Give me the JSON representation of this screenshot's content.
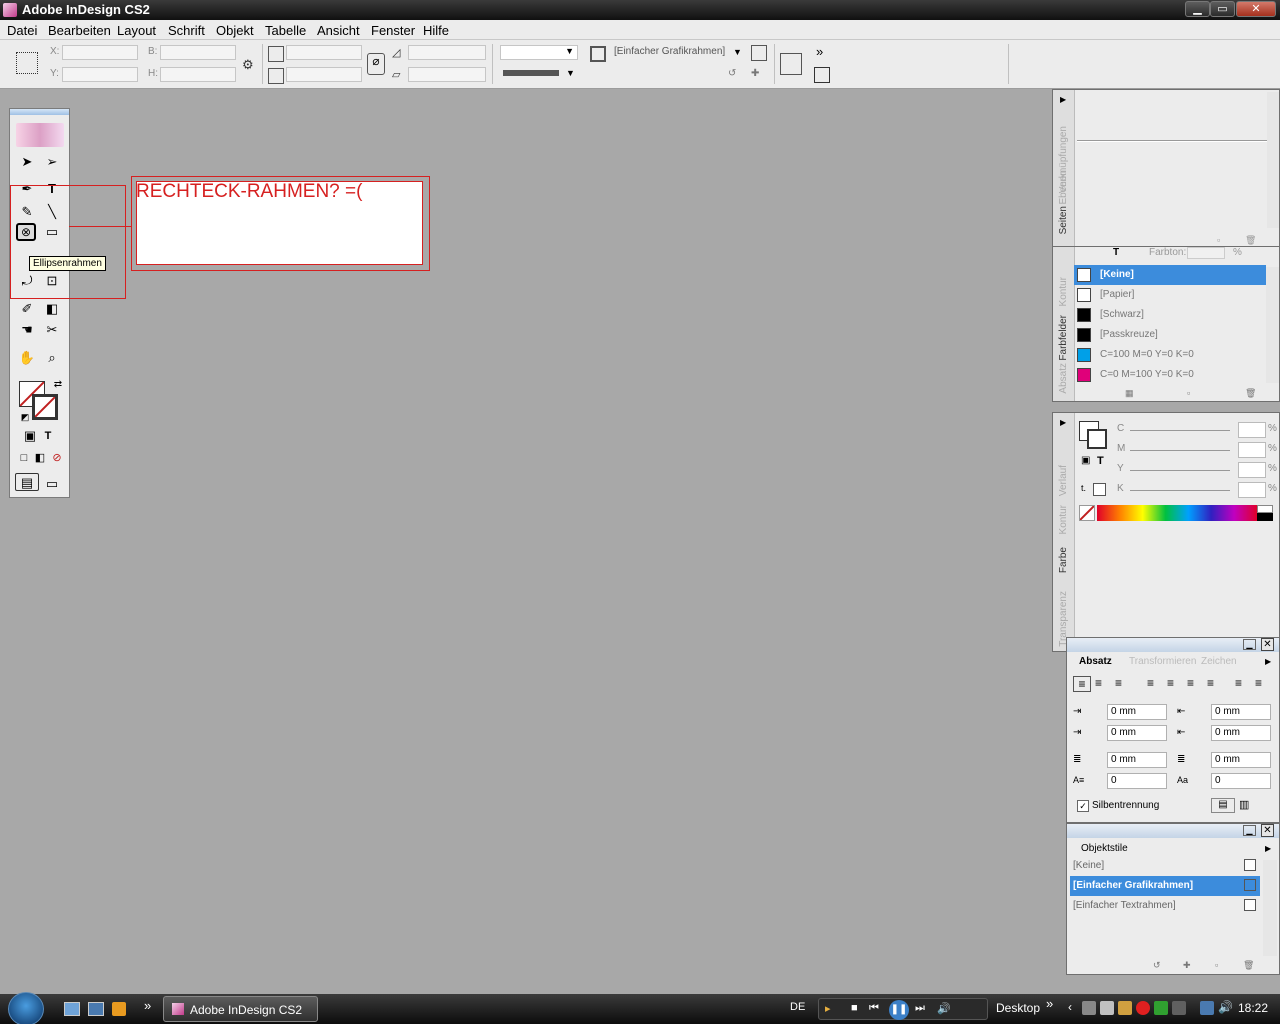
{
  "window": {
    "title": "Adobe InDesign CS2",
    "minimize": "▁",
    "maximize": "▭",
    "close": "✕"
  },
  "menu": [
    "Datei",
    "Bearbeiten",
    "Layout",
    "Schrift",
    "Objekt",
    "Tabelle",
    "Ansicht",
    "Fenster",
    "Hilfe"
  ],
  "control": {
    "x_label": "X:",
    "y_label": "Y:",
    "w_label": "B:",
    "h_label": "H:",
    "object_style": "[Einfacher Grafikrahmen]",
    "more": "»"
  },
  "document": {
    "frame_text": "RECHTECK-RAHMEN? =(",
    "tooltip": "Ellipsenrahmen"
  },
  "pages_panel": {
    "tabs": [
      "Seiten",
      "Ebenen",
      "Verknüpfungen"
    ]
  },
  "swatches_panel": {
    "tint_label": "Farbton:",
    "tint_unit": "%",
    "tabs": [
      "Farbfelder",
      "Absatz",
      "Kontur"
    ],
    "items": [
      {
        "name": "[Keine]",
        "color": "#ffffff",
        "selected": true
      },
      {
        "name": "[Papier]",
        "color": "#ffffff",
        "selected": false
      },
      {
        "name": "[Schwarz]",
        "color": "#000000",
        "selected": false
      },
      {
        "name": "[Passkreuze]",
        "color": "#000000",
        "selected": false
      },
      {
        "name": "C=100 M=0 Y=0 K=0",
        "color": "#00a0e8",
        "selected": false
      },
      {
        "name": "C=0 M=100 Y=0 K=0",
        "color": "#e0007a",
        "selected": false
      }
    ]
  },
  "color_panel": {
    "tabs": [
      "Farbe",
      "Kontur",
      "Verlauf",
      "Transparenz"
    ],
    "channels": [
      {
        "label": "C",
        "unit": "%"
      },
      {
        "label": "M",
        "unit": "%"
      },
      {
        "label": "Y",
        "unit": "%"
      },
      {
        "label": "K",
        "unit": "%"
      }
    ]
  },
  "paragraph_panel": {
    "tabs": [
      "Absatz",
      "Transformieren",
      "Zeichen"
    ],
    "fields": [
      {
        "value": "0 mm"
      },
      {
        "value": "0 mm"
      },
      {
        "value": "0 mm"
      },
      {
        "value": "0 mm"
      },
      {
        "value": "0 mm"
      },
      {
        "value": "0 mm"
      },
      {
        "value": "0"
      },
      {
        "value": "0"
      }
    ],
    "hyphenation": "Silbentrennung",
    "hyphenation_checked": true
  },
  "object_styles_panel": {
    "title": "Objektstile",
    "items": [
      {
        "name": "[Keine]",
        "selected": false
      },
      {
        "name": "[Einfacher Grafikrahmen]",
        "selected": true
      },
      {
        "name": "[Einfacher Textrahmen]",
        "selected": false
      }
    ]
  },
  "taskbar": {
    "task": "Adobe InDesign CS2",
    "lang": "DE",
    "desktop": "Desktop",
    "more": "»",
    "clock": "18:22"
  }
}
